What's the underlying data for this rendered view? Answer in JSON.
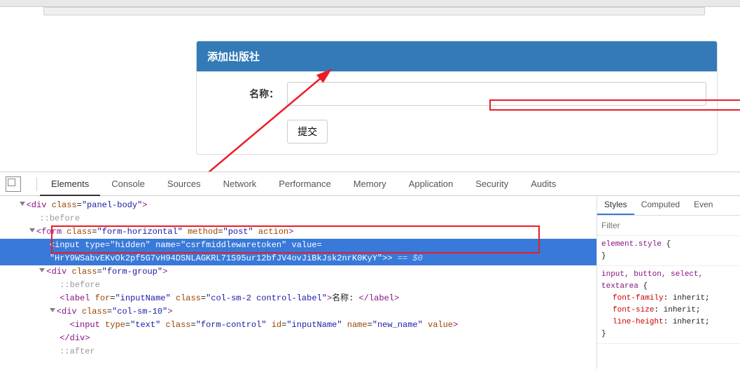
{
  "panel": {
    "title": "添加出版社",
    "label": "名称：",
    "input_value": "",
    "submit_label": "提交"
  },
  "devtools": {
    "tabs": [
      "Elements",
      "Console",
      "Sources",
      "Network",
      "Performance",
      "Memory",
      "Application",
      "Security",
      "Audits"
    ],
    "active_tab": "Elements",
    "dom": {
      "l1": "<div class=\"panel-body\">",
      "l2": "::before",
      "l3": "<form class=\"form-horizontal\" method=\"post\" action>",
      "l4a": "<input type=\"hidden\" name=\"csrfmiddlewaretoken\" value=",
      "l4b": "\"HrY9WSabvEKvOk2pf5G7vH94DSNLAGKRL71S95ur12bfJV4ovJiBkJsk2nrK0KyY\">",
      "l4suffix": " == $0",
      "l5": "<div class=\"form-group\">",
      "l6": "::before",
      "l7": "<label for=\"inputName\" class=\"col-sm-2 control-label\">名称: </label>",
      "l8": "<div class=\"col-sm-10\">",
      "l9": "<input type=\"text\" class=\"form-control\" id=\"inputName\" name=\"new_name\" value>",
      "l10": "</div>",
      "l11": "::after"
    },
    "styles": {
      "tabs": [
        "Styles",
        "Computed",
        "Even"
      ],
      "filter_placeholder": "Filter",
      "rule1_sel": "element.style",
      "rule2_sel": "input, button, select, textarea",
      "rule2_p1": "font-family",
      "rule2_v1": "inherit",
      "rule2_p2": "font-size",
      "rule2_v2": "inherit",
      "rule2_p3": "line-height",
      "rule2_v3": "inherit"
    }
  }
}
